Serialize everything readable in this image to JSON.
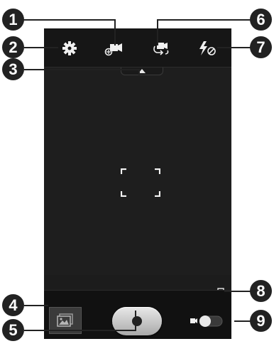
{
  "topbar": {
    "icons": [
      "settings-icon",
      "recording-mode-icon",
      "switch-camera-icon",
      "flash-off-icon"
    ]
  },
  "bottombar": {
    "icons": [
      "gallery-thumbnail-icon",
      "shutter-button",
      "camcorder-camera-switch",
      "storage-icon"
    ]
  },
  "callouts": [
    "1",
    "2",
    "3",
    "4",
    "5",
    "6",
    "7",
    "8",
    "9"
  ],
  "colors": {
    "background": "#1c1c1c",
    "callout": "#222222"
  }
}
